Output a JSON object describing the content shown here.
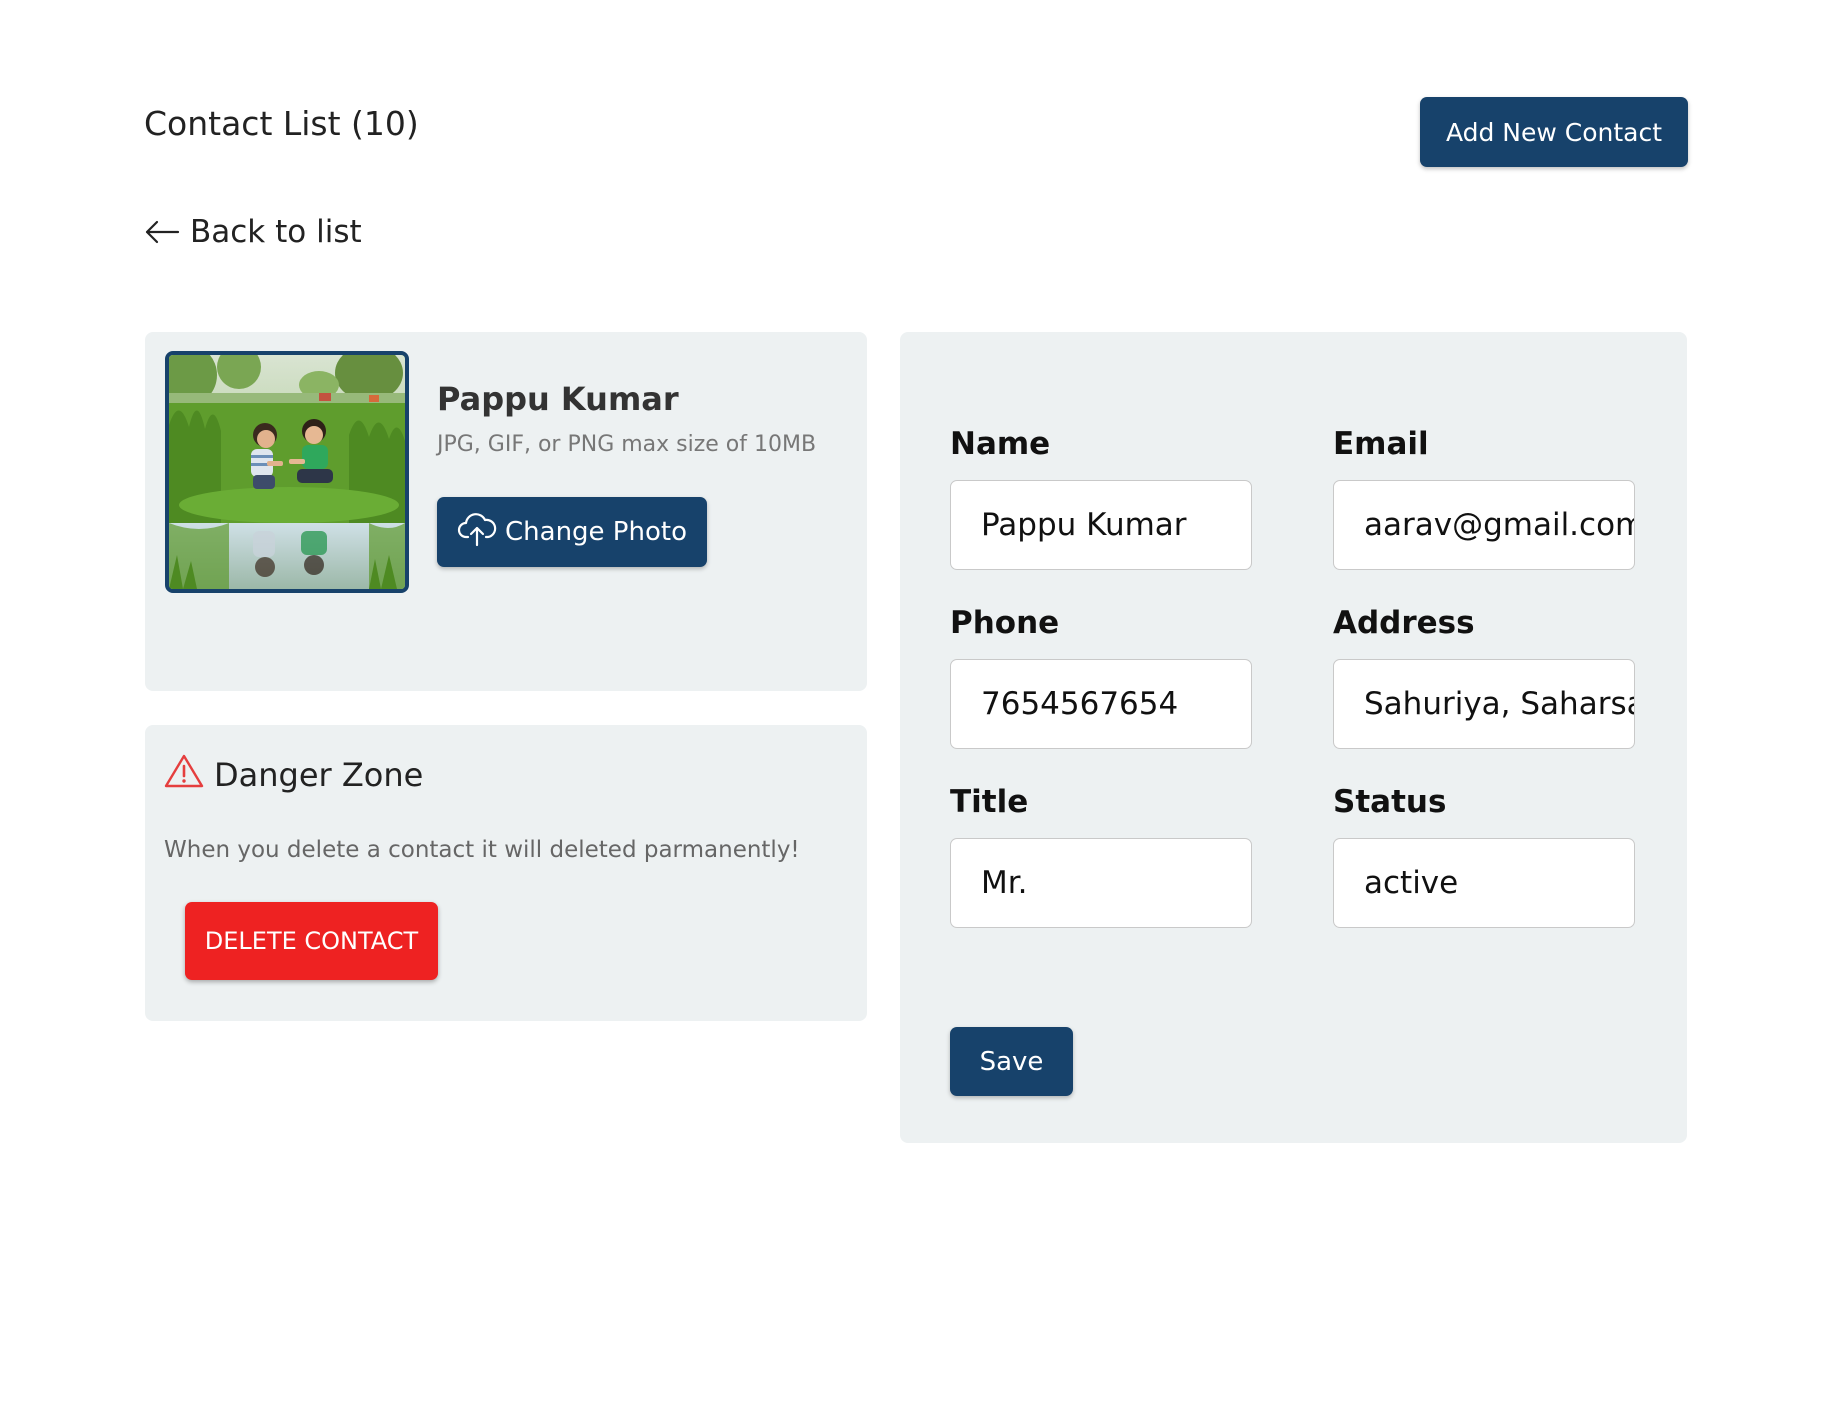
{
  "header": {
    "title": "Contact List (10)",
    "add_button_label": "Add New Contact"
  },
  "back_link": {
    "label": "Back to list",
    "icon": "arrow-left-icon"
  },
  "profile": {
    "name": "Pappu Kumar",
    "photo_hint": "JPG, GIF, or PNG max size of 10MB",
    "change_photo_label": "Change Photo",
    "change_photo_icon": "cloud-upload-icon",
    "avatar_description_icon": "avatar-photo"
  },
  "danger_zone": {
    "title": "Danger Zone",
    "icon": "warning-triangle-icon",
    "message": "When you delete a contact it will deleted parmanently!",
    "delete_label": "DELETE CONTACT"
  },
  "form": {
    "name": {
      "label": "Name",
      "value": "Pappu Kumar"
    },
    "email": {
      "label": "Email",
      "value": "aarav@gmail.com"
    },
    "phone": {
      "label": "Phone",
      "value": "7654567654"
    },
    "address": {
      "label": "Address",
      "value": "Sahuriya, Saharsa"
    },
    "title": {
      "label": "Title",
      "value": "Mr."
    },
    "status": {
      "label": "Status",
      "value": "active"
    },
    "save_label": "Save"
  },
  "colors": {
    "primary": "#17426b",
    "danger": "#ee2222",
    "panel_bg": "#edf1f2",
    "warning_icon": "#e53e3e"
  }
}
